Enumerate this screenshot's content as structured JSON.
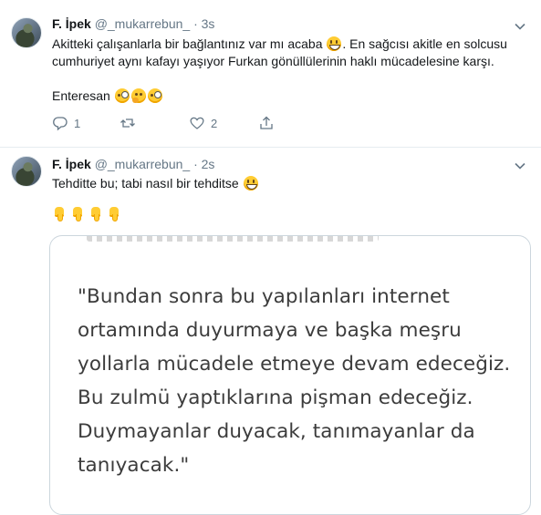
{
  "tweet1": {
    "name": "F. İpek",
    "handle": "@_mukarrebun_",
    "dot": "·",
    "time": "3s",
    "text_line1": "Akitteki çalışanlarla bir bağlantınız var mı acaba",
    "text_line1_after": ". En sağcısı akitle en solcusu",
    "text_line2": "cumhuriyet aynı kafayı yaşıyor Furkan gönüllülerinin haklı mücadelesine karşı.",
    "text_line3": "Enteresan",
    "reply_count": "1",
    "retweet_count": "",
    "like_count": "2"
  },
  "tweet2": {
    "name": "F. İpek",
    "handle": "@_mukarrebun_",
    "dot": "·",
    "time": "2s",
    "text_line1": "Tehditte bu; tabi nasıl bir tehditse",
    "card_quote": "\"Bundan sonra bu yapılanları internet ortamında duyurmaya ve başka meşru yollarla mücadele etmeye devam edeceğiz. Bu zulmü yaptıklarına pişman edeceğiz. Duymayanlar duyacak, tanımayanlar da tanıyacak.\""
  },
  "icons": [
    "chevron-down-icon",
    "reply-icon",
    "retweet-icon",
    "like-icon",
    "share-icon",
    "grinning-face-emoji",
    "face-with-monocle-emoji",
    "thinking-face-emoji",
    "backhand-index-pointing-down-emoji"
  ],
  "colors": {
    "text": "#14171a",
    "muted": "#657786",
    "border": "#ccd6dd"
  }
}
